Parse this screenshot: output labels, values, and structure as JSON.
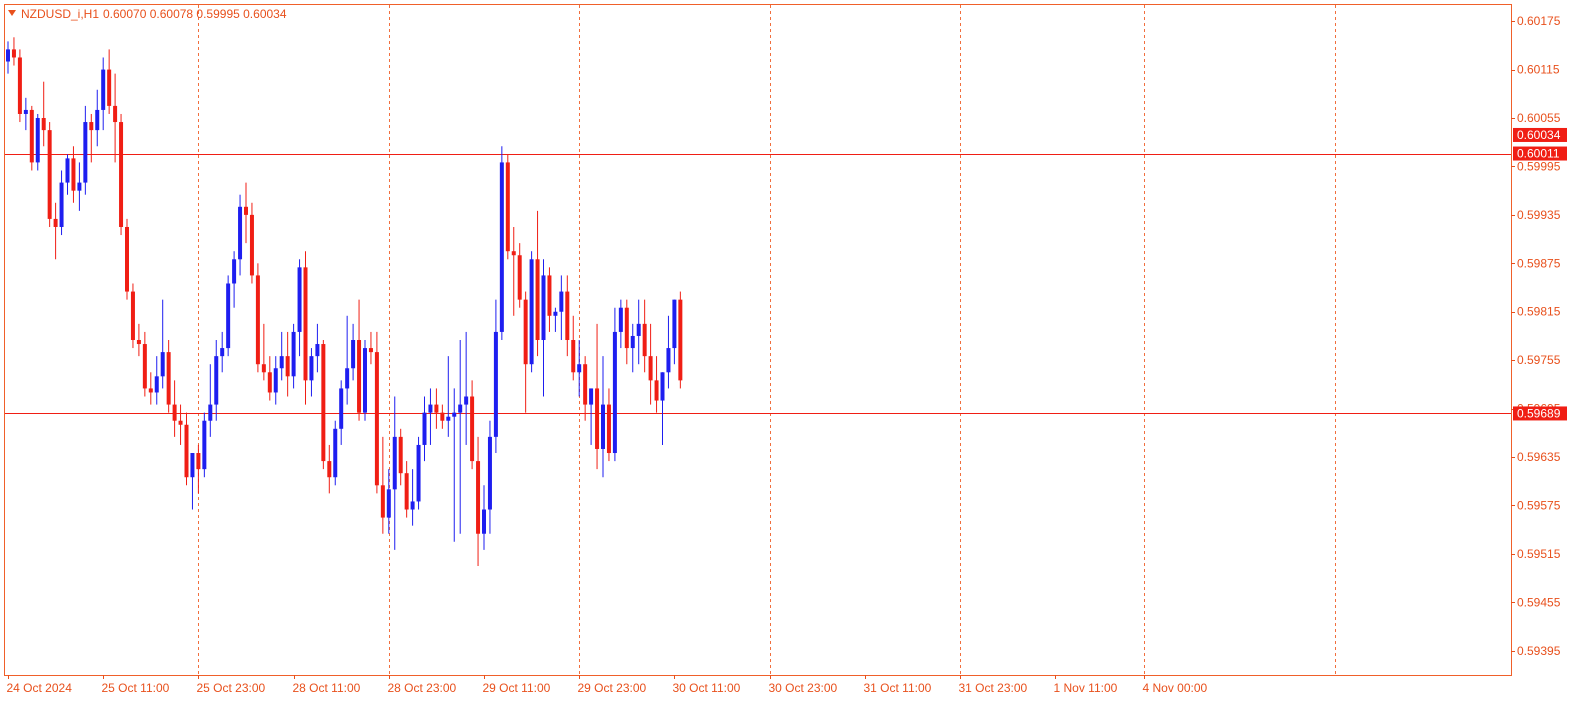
{
  "symbol": "NZDUSD_i,H1",
  "ohlc_header": "0.60070 0.60078 0.59995 0.60034",
  "colors": {
    "bull": "#1e1ef0",
    "bear": "#f01e14",
    "accent": "#e8501c",
    "level": "#f01e14",
    "background": "#ffffff"
  },
  "icons": {
    "menu": "triangle-down-icon"
  },
  "levels": [
    {
      "price": 0.60011,
      "label": "0.60011"
    },
    {
      "price": 0.59689,
      "label": "0.59689"
    }
  ],
  "current_price": {
    "price": 0.60034,
    "label": "0.60034"
  },
  "chart_data": {
    "type": "candlestick",
    "timeframe": "H1",
    "ylim": [
      0.59365,
      0.60195
    ],
    "y_ticks": [
      "0.60175",
      "0.60115",
      "0.60055",
      "0.59995",
      "0.59935",
      "0.59875",
      "0.59815",
      "0.59755",
      "0.59695",
      "0.59635",
      "0.59575",
      "0.59515",
      "0.59455",
      "0.59395"
    ],
    "x_ticks": [
      {
        "label": "24 Oct 2024",
        "bar": 0
      },
      {
        "label": "25 Oct 11:00",
        "bar": 16
      },
      {
        "label": "25 Oct 23:00",
        "bar": 32
      },
      {
        "label": "28 Oct 11:00",
        "bar": 48
      },
      {
        "label": "28 Oct 23:00",
        "bar": 64
      },
      {
        "label": "29 Oct 11:00",
        "bar": 80
      },
      {
        "label": "29 Oct 23:00",
        "bar": 96
      },
      {
        "label": "30 Oct 11:00",
        "bar": 112
      },
      {
        "label": "30 Oct 23:00",
        "bar": 128
      },
      {
        "label": "31 Oct 11:00",
        "bar": 144
      },
      {
        "label": "31 Oct 23:00",
        "bar": 160
      },
      {
        "label": "1 Nov 11:00",
        "bar": 176
      },
      {
        "label": "4 Nov 00:00",
        "bar": 191
      }
    ],
    "vertical_gridlines_at_bars": [
      32,
      64,
      96,
      128,
      160,
      191,
      223
    ],
    "candles": [
      [
        0.60125,
        0.6015,
        0.6011,
        0.6014
      ],
      [
        0.6014,
        0.60155,
        0.6012,
        0.6013
      ],
      [
        0.6013,
        0.6014,
        0.6005,
        0.6006
      ],
      [
        0.6006,
        0.6008,
        0.6004,
        0.60065
      ],
      [
        0.60065,
        0.6007,
        0.5999,
        0.6
      ],
      [
        0.6,
        0.6006,
        0.5999,
        0.60055
      ],
      [
        0.60055,
        0.601,
        0.6002,
        0.6004
      ],
      [
        0.6004,
        0.6005,
        0.5992,
        0.5993
      ],
      [
        0.5993,
        0.5995,
        0.5988,
        0.5992
      ],
      [
        0.5992,
        0.5999,
        0.5991,
        0.59975
      ],
      [
        0.59975,
        0.6001,
        0.5996,
        0.60005
      ],
      [
        0.60005,
        0.6002,
        0.5995,
        0.59965
      ],
      [
        0.59965,
        0.6,
        0.5994,
        0.59975
      ],
      [
        0.59975,
        0.6007,
        0.5996,
        0.6005
      ],
      [
        0.6005,
        0.6006,
        0.6,
        0.6004
      ],
      [
        0.6004,
        0.6009,
        0.6002,
        0.60065
      ],
      [
        0.60065,
        0.6013,
        0.6004,
        0.60115
      ],
      [
        0.60115,
        0.6014,
        0.6006,
        0.6007
      ],
      [
        0.6007,
        0.6011,
        0.6,
        0.6005
      ],
      [
        0.6005,
        0.6006,
        0.5991,
        0.5992
      ],
      [
        0.5992,
        0.5993,
        0.5983,
        0.5984
      ],
      [
        0.5984,
        0.5985,
        0.5977,
        0.5978
      ],
      [
        0.5978,
        0.598,
        0.5976,
        0.59775
      ],
      [
        0.59775,
        0.5979,
        0.5971,
        0.5972
      ],
      [
        0.5972,
        0.5974,
        0.597,
        0.59715
      ],
      [
        0.59715,
        0.5976,
        0.597,
        0.59735
      ],
      [
        0.59735,
        0.5983,
        0.5972,
        0.59765
      ],
      [
        0.59765,
        0.5978,
        0.5969,
        0.597
      ],
      [
        0.597,
        0.5973,
        0.5966,
        0.5968
      ],
      [
        0.5968,
        0.597,
        0.5965,
        0.59675
      ],
      [
        0.59675,
        0.5969,
        0.596,
        0.5961
      ],
      [
        0.5961,
        0.5964,
        0.5957,
        0.5964
      ],
      [
        0.5964,
        0.5965,
        0.5959,
        0.5962
      ],
      [
        0.5962,
        0.5969,
        0.5961,
        0.5968
      ],
      [
        0.5968,
        0.5975,
        0.5966,
        0.597
      ],
      [
        0.597,
        0.5978,
        0.5968,
        0.5976
      ],
      [
        0.5976,
        0.5979,
        0.5974,
        0.5977
      ],
      [
        0.5977,
        0.5986,
        0.5976,
        0.5985
      ],
      [
        0.5985,
        0.5989,
        0.5982,
        0.5988
      ],
      [
        0.5988,
        0.5996,
        0.5986,
        0.59945
      ],
      [
        0.59945,
        0.59975,
        0.599,
        0.59935
      ],
      [
        0.59935,
        0.5995,
        0.5985,
        0.5986
      ],
      [
        0.5986,
        0.59875,
        0.5974,
        0.5975
      ],
      [
        0.5975,
        0.598,
        0.5973,
        0.5974
      ],
      [
        0.5974,
        0.5976,
        0.59705,
        0.59715
      ],
      [
        0.59715,
        0.5976,
        0.597,
        0.59745
      ],
      [
        0.59745,
        0.5979,
        0.5973,
        0.5976
      ],
      [
        0.5976,
        0.5979,
        0.5971,
        0.59735
      ],
      [
        0.59735,
        0.598,
        0.5972,
        0.5979
      ],
      [
        0.5979,
        0.5988,
        0.5976,
        0.5987
      ],
      [
        0.5987,
        0.5989,
        0.597,
        0.5973
      ],
      [
        0.5973,
        0.5977,
        0.5971,
        0.5976
      ],
      [
        0.5976,
        0.598,
        0.5974,
        0.59775
      ],
      [
        0.59775,
        0.5978,
        0.5962,
        0.5963
      ],
      [
        0.5963,
        0.5965,
        0.5959,
        0.5961
      ],
      [
        0.5961,
        0.5968,
        0.596,
        0.5967
      ],
      [
        0.5967,
        0.5973,
        0.5965,
        0.5972
      ],
      [
        0.5972,
        0.5981,
        0.597,
        0.59745
      ],
      [
        0.59745,
        0.598,
        0.5973,
        0.5978
      ],
      [
        0.5978,
        0.5983,
        0.5968,
        0.5969
      ],
      [
        0.5969,
        0.5978,
        0.5968,
        0.5977
      ],
      [
        0.5977,
        0.5979,
        0.5975,
        0.59765
      ],
      [
        0.59765,
        0.5979,
        0.5959,
        0.596
      ],
      [
        0.596,
        0.5966,
        0.5954,
        0.5956
      ],
      [
        0.5956,
        0.5962,
        0.5954,
        0.59595
      ],
      [
        0.59595,
        0.5971,
        0.5952,
        0.5966
      ],
      [
        0.5966,
        0.5967,
        0.596,
        0.59615
      ],
      [
        0.59615,
        0.5963,
        0.5956,
        0.5957
      ],
      [
        0.5957,
        0.5962,
        0.5955,
        0.5958
      ],
      [
        0.5958,
        0.5966,
        0.5957,
        0.5965
      ],
      [
        0.5965,
        0.5971,
        0.5963,
        0.5969
      ],
      [
        0.5969,
        0.5972,
        0.5965,
        0.597
      ],
      [
        0.597,
        0.5972,
        0.5967,
        0.5969
      ],
      [
        0.5969,
        0.597,
        0.5967,
        0.5968
      ],
      [
        0.5968,
        0.5976,
        0.5966,
        0.59685
      ],
      [
        0.59685,
        0.5972,
        0.5953,
        0.5969
      ],
      [
        0.5969,
        0.5978,
        0.5954,
        0.597
      ],
      [
        0.597,
        0.5979,
        0.5965,
        0.5971
      ],
      [
        0.5971,
        0.5973,
        0.5962,
        0.5963
      ],
      [
        0.5963,
        0.5966,
        0.595,
        0.5954
      ],
      [
        0.5954,
        0.596,
        0.5952,
        0.5957
      ],
      [
        0.5957,
        0.5968,
        0.5954,
        0.5966
      ],
      [
        0.5966,
        0.5983,
        0.5964,
        0.5979
      ],
      [
        0.5979,
        0.6002,
        0.5978,
        0.6
      ],
      [
        0.6,
        0.6001,
        0.5988,
        0.5989
      ],
      [
        0.5989,
        0.5992,
        0.5981,
        0.59885
      ],
      [
        0.59885,
        0.599,
        0.5982,
        0.5983
      ],
      [
        0.5983,
        0.5984,
        0.5969,
        0.5975
      ],
      [
        0.5975,
        0.5989,
        0.5974,
        0.5988
      ],
      [
        0.5988,
        0.5994,
        0.5976,
        0.5978
      ],
      [
        0.5978,
        0.5988,
        0.5971,
        0.5986
      ],
      [
        0.5986,
        0.5987,
        0.5979,
        0.5981
      ],
      [
        0.5981,
        0.5982,
        0.5979,
        0.59815
      ],
      [
        0.59815,
        0.5986,
        0.5978,
        0.5984
      ],
      [
        0.5984,
        0.5986,
        0.5976,
        0.5978
      ],
      [
        0.5978,
        0.5981,
        0.5973,
        0.5974
      ],
      [
        0.5974,
        0.5978,
        0.5971,
        0.5975
      ],
      [
        0.5975,
        0.5976,
        0.5968,
        0.597
      ],
      [
        0.597,
        0.5972,
        0.5965,
        0.5972
      ],
      [
        0.5972,
        0.598,
        0.5962,
        0.59645
      ],
      [
        0.59645,
        0.5976,
        0.5961,
        0.597
      ],
      [
        0.597,
        0.5972,
        0.5963,
        0.5964
      ],
      [
        0.5964,
        0.5982,
        0.5963,
        0.5979
      ],
      [
        0.5979,
        0.5983,
        0.5977,
        0.5982
      ],
      [
        0.5982,
        0.5983,
        0.5975,
        0.5977
      ],
      [
        0.5977,
        0.598,
        0.5974,
        0.59785
      ],
      [
        0.59785,
        0.5983,
        0.5975,
        0.598
      ],
      [
        0.598,
        0.5983,
        0.5974,
        0.5976
      ],
      [
        0.5976,
        0.598,
        0.597,
        0.5973
      ],
      [
        0.5973,
        0.5976,
        0.5969,
        0.59705
      ],
      [
        0.59705,
        0.5974,
        0.5965,
        0.5974
      ],
      [
        0.5974,
        0.5981,
        0.5972,
        0.5977
      ],
      [
        0.5977,
        0.5983,
        0.5975,
        0.5983
      ],
      [
        0.5983,
        0.5984,
        0.5972,
        0.5973
      ]
    ]
  }
}
